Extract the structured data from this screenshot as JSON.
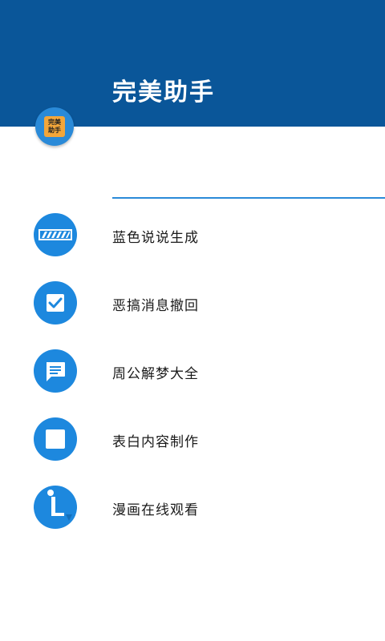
{
  "header": {
    "title": "完美助手",
    "badge_line1": "完美",
    "badge_line2": "助手"
  },
  "colors": {
    "header_bg": "#0a5699",
    "accent": "#1d88de",
    "badge_orange": "#f3a63a"
  },
  "menu": {
    "items": [
      {
        "label": "蓝色说说生成",
        "icon": "progress-bar-icon"
      },
      {
        "label": "恶搞消息撤回",
        "icon": "checkbox-icon"
      },
      {
        "label": "周公解梦大全",
        "icon": "chat-bubble-icon"
      },
      {
        "label": "表白内容制作",
        "icon": "square-icon"
      },
      {
        "label": "漫画在线观看",
        "icon": "l-clock-icon"
      }
    ]
  }
}
